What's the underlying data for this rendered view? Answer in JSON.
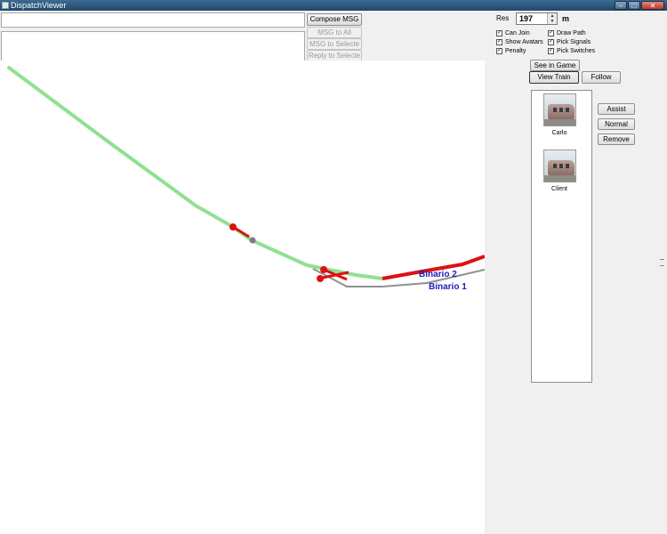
{
  "window": {
    "title": "DispatchViewer",
    "controls": {
      "minimize": "–",
      "maximize": "□",
      "close": "✕"
    }
  },
  "messages": {
    "compose_label": "Compose MSG",
    "msg_all_label": "MSG to All",
    "msg_selected_label": "MSG to Selecte",
    "reply_selected_label": "Reply to Selecte",
    "input_value": "",
    "body_value": ""
  },
  "res": {
    "label": "Res",
    "value": "197",
    "unit": "m",
    "spin_up": "▲",
    "spin_down": "▼"
  },
  "options": [
    {
      "label": "Can Join",
      "checked": true
    },
    {
      "label": "Show Avatars",
      "checked": true
    },
    {
      "label": "Penalty",
      "checked": true
    },
    {
      "label": "Draw Path",
      "checked": true
    },
    {
      "label": "Pick Signals",
      "checked": true
    },
    {
      "label": "Pick Switches",
      "checked": true
    }
  ],
  "actions": {
    "see_in_game": "See in Game",
    "view_train": "View Train",
    "follow": "Follow"
  },
  "trains": [
    {
      "name": "Carlo"
    },
    {
      "name": "Client"
    }
  ],
  "train_actions": {
    "assist": "Assist",
    "normal": "Normal",
    "remove": "Remove"
  },
  "map": {
    "track_labels": [
      "Binario 2",
      "Binario 1"
    ],
    "colors": {
      "path": "#90e090",
      "occupied": "#dd1111",
      "track": "#909090",
      "label": "#2020c0"
    }
  }
}
